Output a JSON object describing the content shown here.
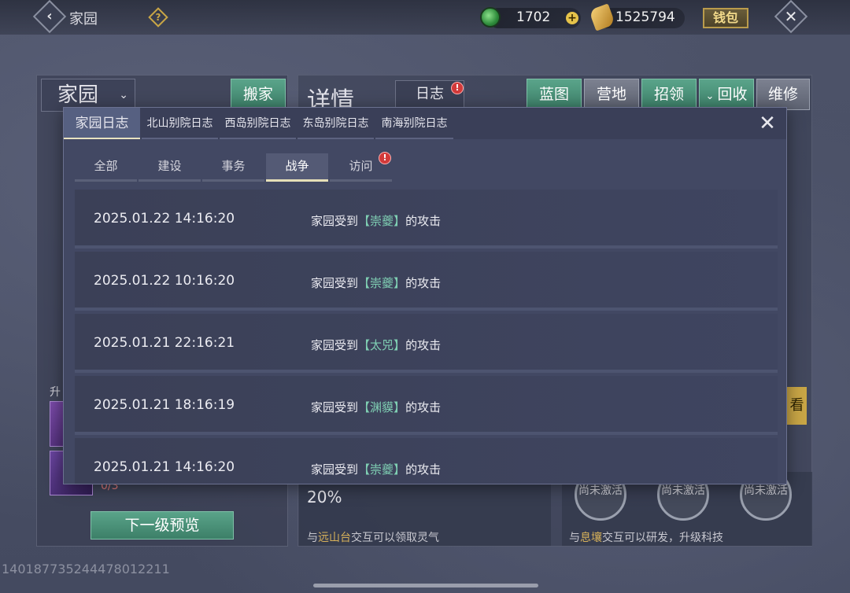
{
  "topbar": {
    "back_icon": "chevron-left-icon",
    "title": "家园",
    "help_icon": "question-icon",
    "jade_amount": "1702",
    "gold_amount": "1525794",
    "wallet_label": "钱包"
  },
  "left_panel": {
    "home_select": "家园",
    "move_label": "搬家",
    "upgrade_label": "升",
    "slot_count": "0/3",
    "next_preview_label": "下一级预览"
  },
  "right_panel": {
    "details_title": "详情",
    "log_tab_label": "日志",
    "buttons": {
      "blueprint": "蓝图",
      "camp": "营地",
      "recruit": "招领",
      "recycle": "回收",
      "repair": "维修"
    },
    "percent": "20%",
    "mid_hint_prefix": "与",
    "mid_hint_place": "远山台",
    "mid_hint_suffix": "交互可以领取灵气",
    "right_hint_prefix": "与",
    "right_hint_place": "息壤",
    "right_hint_suffix": "交互可以研发，升级科技",
    "ring_label": "尚未激活",
    "side_btn": "看"
  },
  "uid": "1401877352444780122​11",
  "modal": {
    "tabs": [
      "家园日志",
      "北山别院日志",
      "西岛别院日志",
      "东岛别院日志",
      "南海别院日志"
    ],
    "subtabs": [
      "全部",
      "建设",
      "事务",
      "战争",
      "访问"
    ],
    "active_subtab": "战争",
    "logs": [
      {
        "time": "2025.01.22 14:16:20",
        "prefix": "家园受到",
        "enemy": "崇夔",
        "suffix": "的攻击"
      },
      {
        "time": "2025.01.22 10:16:20",
        "prefix": "家园受到",
        "enemy": "崇夔",
        "suffix": "的攻击"
      },
      {
        "time": "2025.01.21 22:16:21",
        "prefix": "家园受到",
        "enemy": "太兕",
        "suffix": "的攻击"
      },
      {
        "time": "2025.01.21 18:16:19",
        "prefix": "家园受到",
        "enemy": "渊貘",
        "suffix": "的攻击"
      },
      {
        "time": "2025.01.21 14:16:20",
        "prefix": "家园受到",
        "enemy": "崇夔",
        "suffix": "的攻击"
      }
    ],
    "bracket_open": "【",
    "bracket_close": "】"
  }
}
